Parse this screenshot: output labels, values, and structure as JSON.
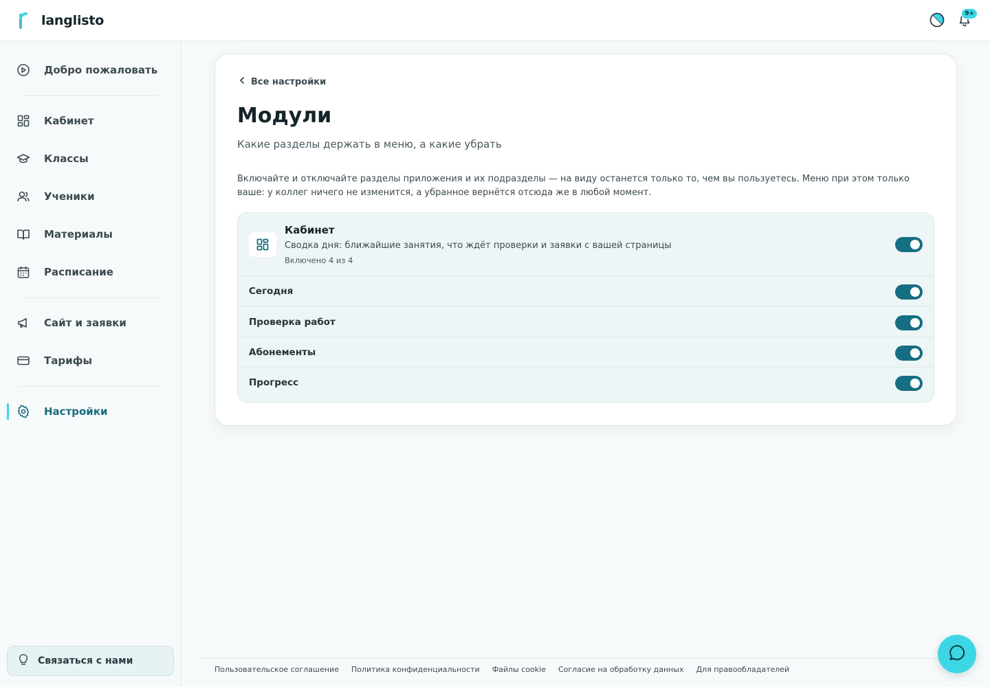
{
  "app": {
    "name": "langlisto",
    "notifications_badge": "9+"
  },
  "sidebar": {
    "items": [
      {
        "label": "Добро пожаловать",
        "icon": "play-circle-icon"
      },
      {
        "label": "Кабинет",
        "icon": "dashboard-grid-icon"
      },
      {
        "label": "Классы",
        "icon": "graduation-cap-icon"
      },
      {
        "label": "Ученики",
        "icon": "users-icon"
      },
      {
        "label": "Материалы",
        "icon": "book-open-icon"
      },
      {
        "label": "Расписание",
        "icon": "calendar-icon"
      },
      {
        "label": "Сайт и заявки",
        "icon": "megaphone-icon"
      },
      {
        "label": "Тарифы",
        "icon": "credit-card-icon"
      },
      {
        "label": "Настройки",
        "icon": "gear-icon",
        "active": true
      }
    ],
    "contact_label": "Связаться с нами"
  },
  "main": {
    "back_label": "Все настройки",
    "title": "Модули",
    "subtitle": "Какие разделы держать в меню, а какие убрать",
    "description": "Включайте и отключайте разделы приложения и их подразделы — на виду останется только то, чем вы пользуетесь. Меню при этом только ваше: у коллег ничего не изменится, а убранное вернётся отсюда же в любой момент.",
    "module": {
      "title": "Кабинет",
      "description": "Сводка дня: ближайшие занятия, что ждёт проверки и заявки с вашей страницы",
      "count": "Включено 4 из 4",
      "enabled": true,
      "subsections": [
        {
          "label": "Сегодня",
          "enabled": true
        },
        {
          "label": "Проверка работ",
          "enabled": true
        },
        {
          "label": "Абонементы",
          "enabled": true
        },
        {
          "label": "Прогресс",
          "enabled": true
        }
      ]
    }
  },
  "footer": {
    "links": [
      "Пользовательское соглашение",
      "Политика конфиденциальности",
      "Файлы cookie",
      "Согласие на обработку данных",
      "Для правообладателей"
    ]
  },
  "colors": {
    "accent": "#156e82",
    "brand": "#3dd6e4",
    "active_nav": "#1a6b7e"
  }
}
